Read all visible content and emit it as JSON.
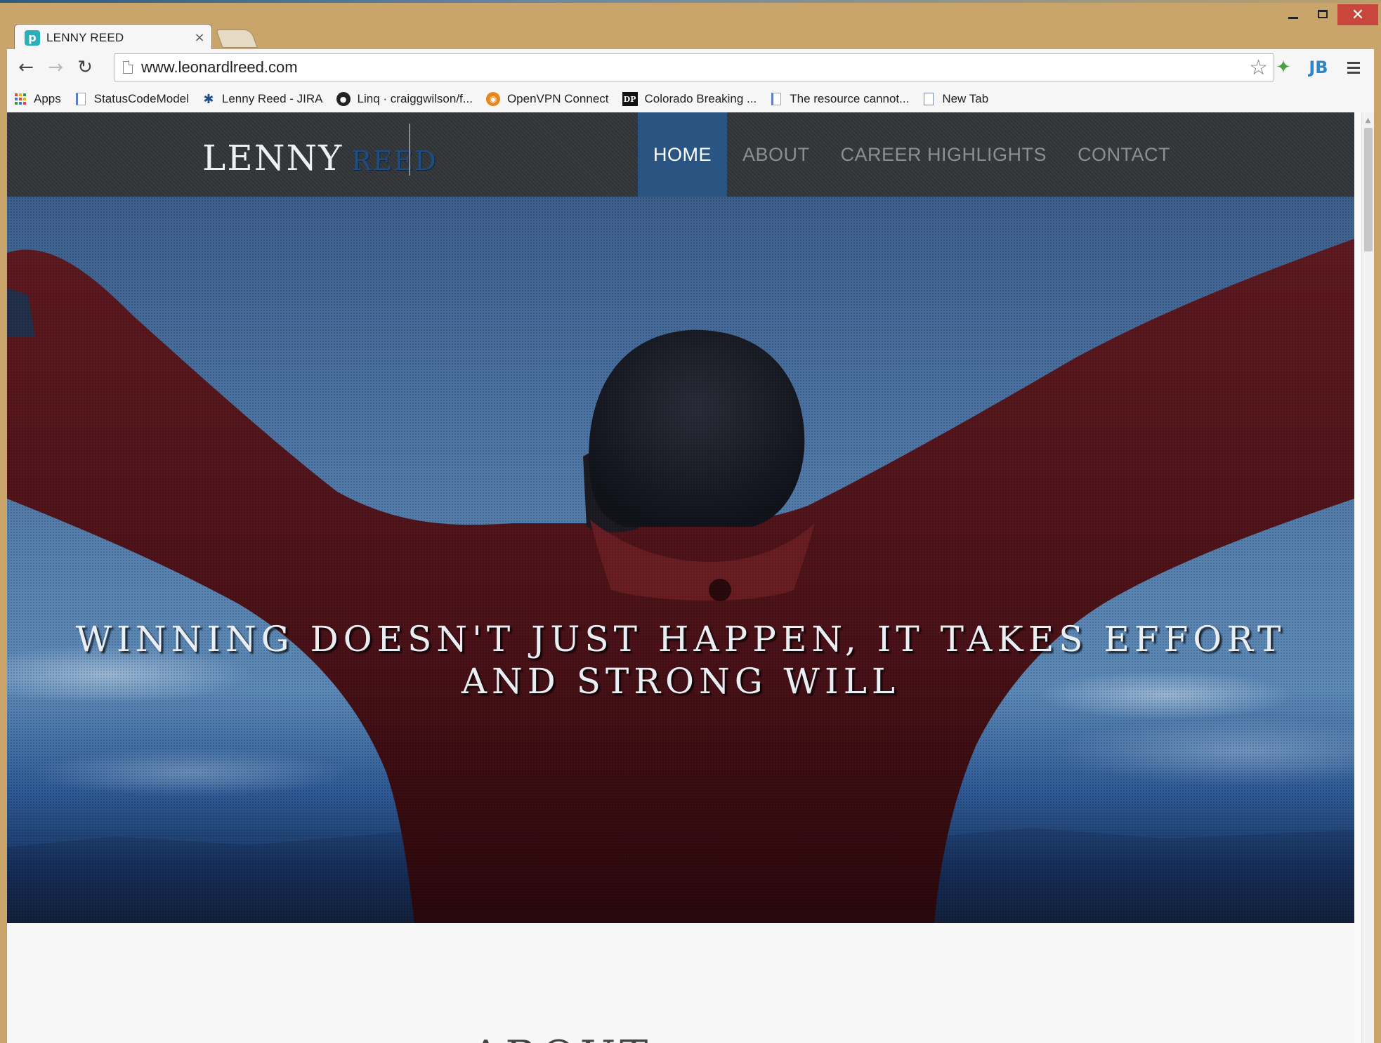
{
  "browser": {
    "tab": {
      "title": "LENNY REED",
      "favicon_letter": "p",
      "close_glyph": "×"
    },
    "toolbar": {
      "url": "www.leonardlreed.com",
      "back_glyph": "←",
      "forward_glyph": "→",
      "reload_glyph": "↻",
      "star_glyph": "☆",
      "extension_jb_label": "JB"
    },
    "bookmarks": [
      {
        "label": "Apps",
        "icon": "apps-icon"
      },
      {
        "label": "StatusCodeModel",
        "icon": "document-icon"
      },
      {
        "label": "Lenny Reed - JIRA",
        "icon": "jira-icon"
      },
      {
        "label": "Linq · craiggwilson/f...",
        "icon": "github-icon"
      },
      {
        "label": "OpenVPN Connect",
        "icon": "openvpn-icon"
      },
      {
        "label": "Colorado Breaking ...",
        "icon": "dp-icon",
        "icon_text": "DP"
      },
      {
        "label": "The resource cannot...",
        "icon": "document-icon"
      },
      {
        "label": "New Tab",
        "icon": "page-icon"
      }
    ]
  },
  "site": {
    "logo": {
      "first": "LENNY",
      "last": "REED"
    },
    "nav": [
      {
        "label": "HOME",
        "active": true
      },
      {
        "label": "ABOUT",
        "active": false
      },
      {
        "label": "CAREER HIGHLIGHTS",
        "active": false
      },
      {
        "label": "CONTACT",
        "active": false
      }
    ],
    "hero": {
      "quote": "WINNING DOESN'T JUST HAPPEN, IT TAKES EFFORT AND STRONG WILL"
    },
    "next_section_heading": "ABOUT"
  },
  "colors": {
    "nav_active_bg": "#2a5583",
    "logo_accent": "#1f4d80",
    "header_bg": "#333638",
    "shirt_red": "#5a1a1e"
  }
}
